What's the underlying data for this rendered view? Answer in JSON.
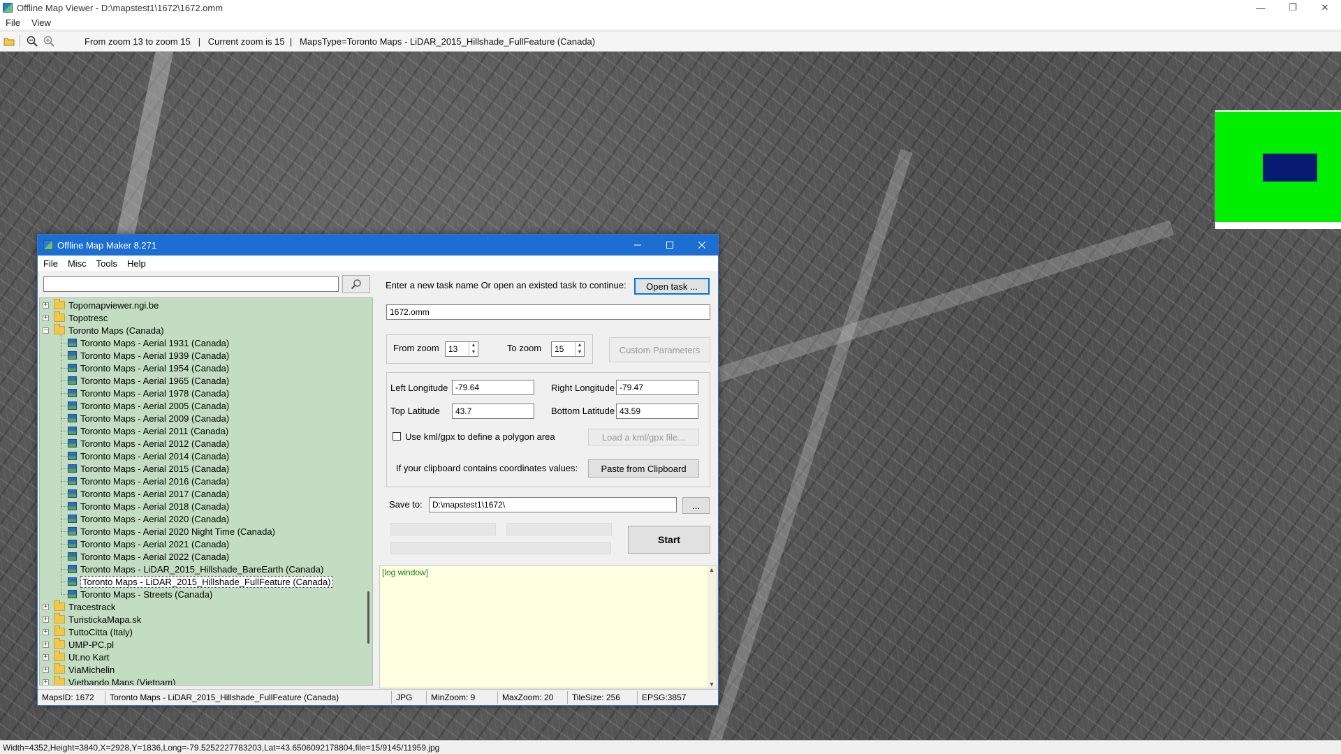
{
  "window": {
    "title": "Offline Map Viewer - D:\\mapstest1\\1672\\1672.omm",
    "menus": [
      "File",
      "View"
    ],
    "controls": [
      "—",
      "❐",
      "✕"
    ]
  },
  "toolbar": {
    "info_text": "From zoom 13 to zoom 15   |   Current zoom is 15  |   MapsType=Toronto Maps - LiDAR_2015_Hillshade_FullFeature (Canada)"
  },
  "statusbar": {
    "text": "Width=4352,Height=3840,X=2928,Y=1836,Long=-79.5252227783203,Lat=43.6506092178804,file=15/9145/11959.jpg"
  },
  "dialog": {
    "title": "Offline Map Maker 8.271",
    "menus": [
      "File",
      "Misc",
      "Tools",
      "Help"
    ],
    "search": {
      "value": "",
      "placeholder": ""
    },
    "tree": [
      {
        "label": "Topomapviewer.ngi.be",
        "type": "folder",
        "expanded": false,
        "level": 0
      },
      {
        "label": "Topotresc",
        "type": "folder",
        "expanded": false,
        "level": 0
      },
      {
        "label": "Toronto Maps (Canada)",
        "type": "folder",
        "expanded": true,
        "level": 0
      },
      {
        "label": "Toronto Maps - Aerial 1931 (Canada)",
        "type": "map",
        "level": 1
      },
      {
        "label": "Toronto Maps - Aerial 1939 (Canada)",
        "type": "map",
        "level": 1
      },
      {
        "label": "Toronto Maps - Aerial 1954 (Canada)",
        "type": "map",
        "level": 1
      },
      {
        "label": "Toronto Maps - Aerial 1965 (Canada)",
        "type": "map",
        "level": 1
      },
      {
        "label": "Toronto Maps - Aerial 1978 (Canada)",
        "type": "map",
        "level": 1
      },
      {
        "label": "Toronto Maps - Aerial 2005 (Canada)",
        "type": "map",
        "level": 1
      },
      {
        "label": "Toronto Maps - Aerial 2009 (Canada)",
        "type": "map",
        "level": 1
      },
      {
        "label": "Toronto Maps - Aerial 2011 (Canada)",
        "type": "map",
        "level": 1
      },
      {
        "label": "Toronto Maps - Aerial 2012 (Canada)",
        "type": "map",
        "level": 1
      },
      {
        "label": "Toronto Maps - Aerial 2014 (Canada)",
        "type": "map",
        "level": 1
      },
      {
        "label": "Toronto Maps - Aerial 2015 (Canada)",
        "type": "map",
        "level": 1
      },
      {
        "label": "Toronto Maps - Aerial 2016 (Canada)",
        "type": "map",
        "level": 1
      },
      {
        "label": "Toronto Maps - Aerial 2017 (Canada)",
        "type": "map",
        "level": 1
      },
      {
        "label": "Toronto Maps - Aerial 2018 (Canada)",
        "type": "map",
        "level": 1
      },
      {
        "label": "Toronto Maps - Aerial 2020 (Canada)",
        "type": "map",
        "level": 1
      },
      {
        "label": "Toronto Maps - Aerial 2020 Night Time (Canada)",
        "type": "map",
        "level": 1
      },
      {
        "label": "Toronto Maps - Aerial 2021 (Canada)",
        "type": "map",
        "level": 1
      },
      {
        "label": "Toronto Maps - Aerial 2022 (Canada)",
        "type": "map",
        "level": 1
      },
      {
        "label": "Toronto Maps - LiDAR_2015_Hillshade_BareEarth (Canada)",
        "type": "map",
        "level": 1
      },
      {
        "label": "Toronto Maps - LiDAR_2015_Hillshade_FullFeature (Canada)",
        "type": "map",
        "level": 1,
        "selected": true
      },
      {
        "label": "Toronto Maps - Streets (Canada)",
        "type": "map",
        "level": 1
      },
      {
        "label": "Tracestrack",
        "type": "folder",
        "expanded": false,
        "level": 0
      },
      {
        "label": "TuristickaMapa.sk",
        "type": "folder",
        "expanded": false,
        "level": 0
      },
      {
        "label": "TuttoCitta (Italy)",
        "type": "folder",
        "expanded": false,
        "level": 0
      },
      {
        "label": "UMP-PC.pl",
        "type": "folder",
        "expanded": false,
        "level": 0
      },
      {
        "label": "Ut.no Kart",
        "type": "folder",
        "expanded": false,
        "level": 0
      },
      {
        "label": "ViaMichelin",
        "type": "folder",
        "expanded": false,
        "level": 0
      },
      {
        "label": "Vietbando Maps (Vietnam)",
        "type": "folder",
        "expanded": false,
        "level": 0
      }
    ],
    "status": {
      "maps_id": "MapsID: 1672",
      "map_name": "Toronto Maps - LiDAR_2015_Hillshade_FullFeature (Canada)",
      "format": "JPG",
      "min_zoom": "MinZoom: 9",
      "max_zoom": "MaxZoom: 20",
      "tile_size": "TileSize: 256",
      "epsg": "EPSG:3857"
    },
    "task": {
      "prompt": "Enter a new task name Or open an existed task to continue:",
      "open_button": "Open task ...",
      "name_value": "1672.omm"
    },
    "zoom": {
      "from_label": "From zoom",
      "from_value": "13",
      "to_label": "To zoom",
      "to_value": "15",
      "custom_button": "Custom Parameters"
    },
    "bounds": {
      "left_label": "Left Longitude",
      "left_value": "-79.64",
      "right_label": "Right Longitude",
      "right_value": "-79.47",
      "top_label": "Top Latitude",
      "top_value": "43.7",
      "bottom_label": "Bottom Latitude",
      "bottom_value": "43.59"
    },
    "kml": {
      "checkbox_label": "Use kml/gpx to define a polygon area",
      "load_button": "Load a kml/gpx file..."
    },
    "clipboard": {
      "label": "If your clipboard contains coordinates values:",
      "paste_button": "Paste from Clipboard"
    },
    "save": {
      "label": "Save to:",
      "path": "D:\\mapstest1\\1672\\",
      "browse_button": "..."
    },
    "start_button": "Start",
    "log_text": "[log window]"
  }
}
